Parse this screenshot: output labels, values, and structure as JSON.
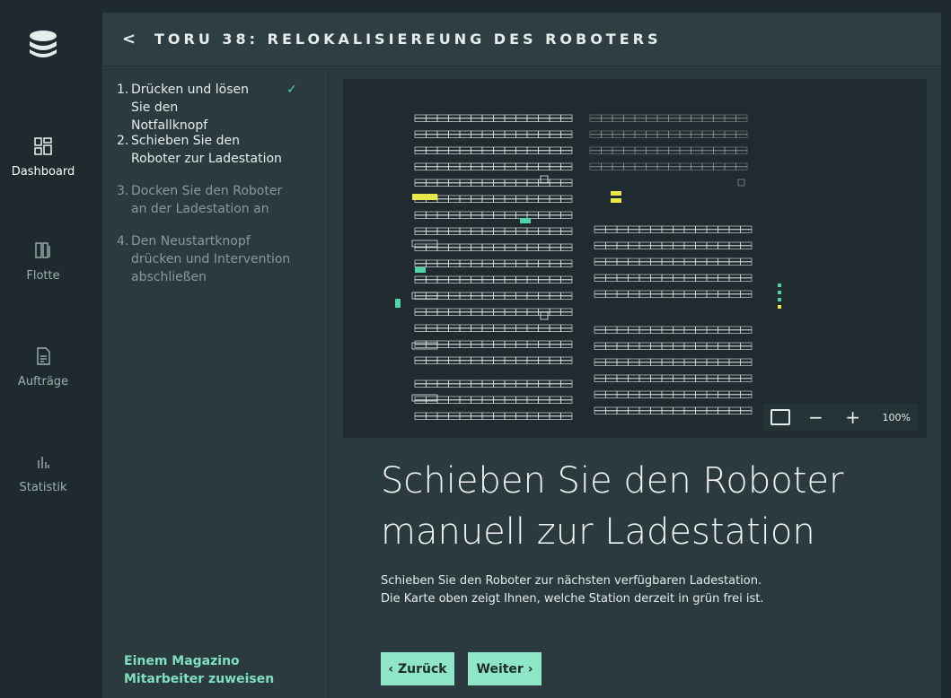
{
  "nav": {
    "items": [
      {
        "label": "Dashboard",
        "icon": "dashboard-icon",
        "active": true
      },
      {
        "label": "Flotte",
        "icon": "fleet-icon",
        "active": false
      },
      {
        "label": "Aufträge",
        "icon": "orders-icon",
        "active": false
      },
      {
        "label": "Statistik",
        "icon": "statistics-icon",
        "active": false
      }
    ]
  },
  "header": {
    "title": "TORU 38: RELOKALISIEREUNG DES ROBOTERS",
    "back_icon": "chevron-left-icon"
  },
  "steps": [
    {
      "num": "1.",
      "text": "Drücken und lösen Sie den Notfallknopf",
      "state": "done"
    },
    {
      "num": "2.",
      "text": "Schieben Sie den Roboter zur Ladestation",
      "state": "current"
    },
    {
      "num": "3.",
      "text": "Docken Sie den Roboter an der Ladestation an",
      "state": "pending"
    },
    {
      "num": "4.",
      "text": "Den Neustartknopf drücken und Intervention abschließen",
      "state": "pending"
    }
  ],
  "check_glyph": "✓",
  "assign_link": "Einem Magazino Mitarbeiter zuweisen",
  "map": {
    "zoom": "100%",
    "controls": {
      "fit": "fit-view-icon",
      "zoom_out": "−",
      "zoom_in": "+"
    },
    "colors": {
      "background": "#1f2b2f",
      "shelf": "#e6ecea",
      "robot_busy": "#e8e84a",
      "robot_free": "#4fd6a7"
    }
  },
  "instruction": {
    "title": "Schieben Sie den Roboter manuell zur Ladestation",
    "body_line1": "Schieben Sie den Roboter zur nächsten verfügbaren Ladestation.",
    "body_line2": "Die Karte oben zeigt Ihnen, welche Station derzeit in grün frei ist."
  },
  "buttons": {
    "back": "‹ Zurück",
    "next": "Weiter ›"
  },
  "colors": {
    "accent": "#8fe6c6",
    "link": "#7fe0bf",
    "check": "#4fd6a7"
  }
}
